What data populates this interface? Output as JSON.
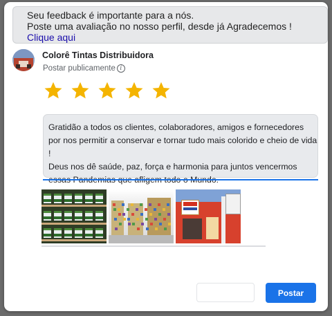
{
  "banner": {
    "line1": "Seu feedback é importante para a nós.",
    "line2": "Poste uma avaliação no nosso perfil, desde já Agradecemos !",
    "link": "Clique aqui"
  },
  "business": {
    "name": "Colorê Tintas Distribuidora",
    "visibility": "Postar publicamente"
  },
  "rating": {
    "stars": 5,
    "max": 5,
    "color": "#f4b400"
  },
  "review": {
    "text": "Gratidão a todos os clientes, colaboradores, amigos e fornecedores por nos permitir a conservar e tornar tudo mais colorido e cheio de vida !\nDeus nos dê saúde, paz, força e harmonia para juntos vencermos essas Pandemias que afligem todo o Mundo."
  },
  "photos": [
    {
      "icon": "paint-cans-shelf-photo"
    },
    {
      "icon": "store-interior-photo"
    },
    {
      "icon": "storefront-photo"
    }
  ],
  "actions": {
    "cancel_label": "",
    "post_label": "Postar"
  },
  "colors": {
    "accent": "#1a73e8",
    "banner_bg": "#e7e8ea",
    "review_bg": "#e8eaed"
  }
}
